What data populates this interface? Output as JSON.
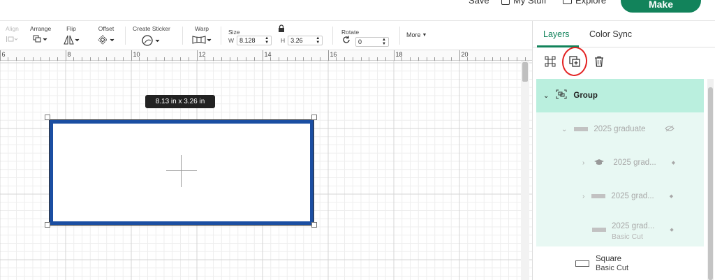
{
  "nav": {
    "save_label": "Save",
    "mystuff_label": "My Stuff",
    "explore_label": "Explore",
    "make_label": "Make"
  },
  "toolbar": {
    "align_label": "Align",
    "arrange_label": "Arrange",
    "flip_label": "Flip",
    "offset_label": "Offset",
    "sticker_label": "Create Sticker",
    "warp_label": "Warp",
    "size_label": "Size",
    "width_prefix": "W",
    "width_value": "8.128",
    "height_prefix": "H",
    "height_value": "3.26",
    "rotate_label": "Rotate",
    "rotate_value": "0",
    "more_label": "More"
  },
  "ruler": {
    "labels": [
      "6",
      "8",
      "10",
      "12",
      "14",
      "16",
      "18",
      "20"
    ]
  },
  "canvas": {
    "size_tooltip": "8.13  in x 3.26  in",
    "shape_stroke_color": "#1b4ea2"
  },
  "panel": {
    "tab_layers": "Layers",
    "tab_colorsync": "Color Sync",
    "accent_color": "#12835b",
    "group_label": "Group",
    "sub_group_label": "2025 graduate",
    "layers": [
      {
        "name": "2025 grad...",
        "icon": "cap-icon"
      },
      {
        "name": "2025 grad...",
        "icon": "text-thumb-icon"
      },
      {
        "name": "2025 grad...",
        "sub": "Basic Cut",
        "icon": "text-thumb-icon"
      }
    ],
    "square_label": "Square",
    "square_sub": "Basic Cut"
  },
  "annotation": {
    "color": "#e32222"
  }
}
